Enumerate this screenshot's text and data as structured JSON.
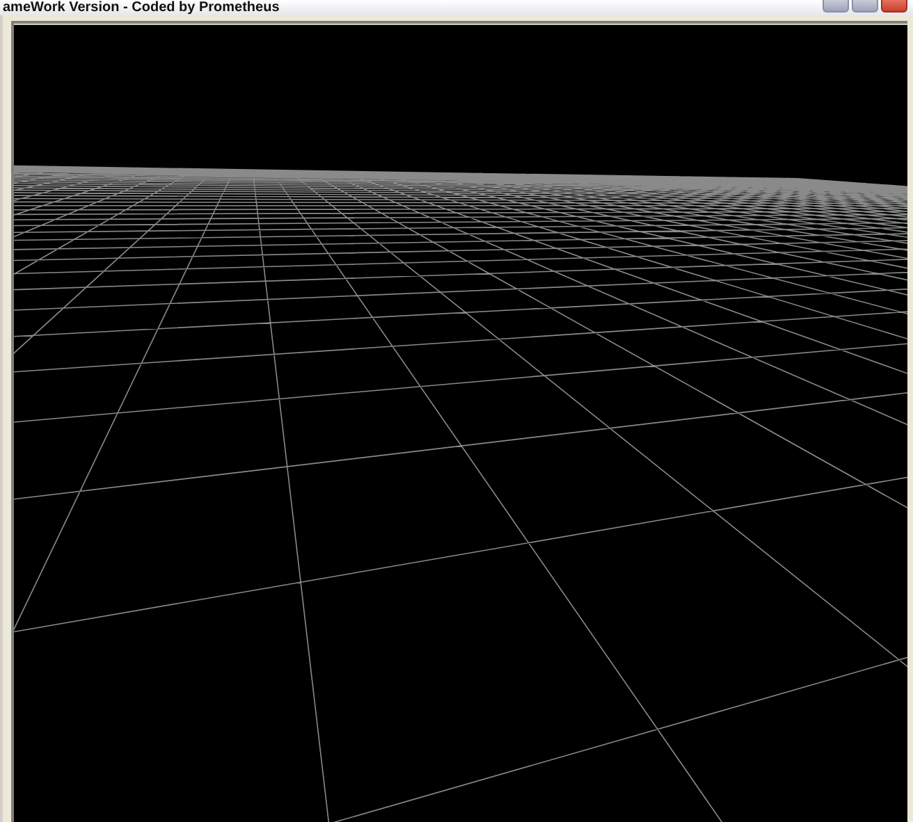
{
  "window": {
    "title": "ameWork Version - Coded by Prometheus"
  }
}
